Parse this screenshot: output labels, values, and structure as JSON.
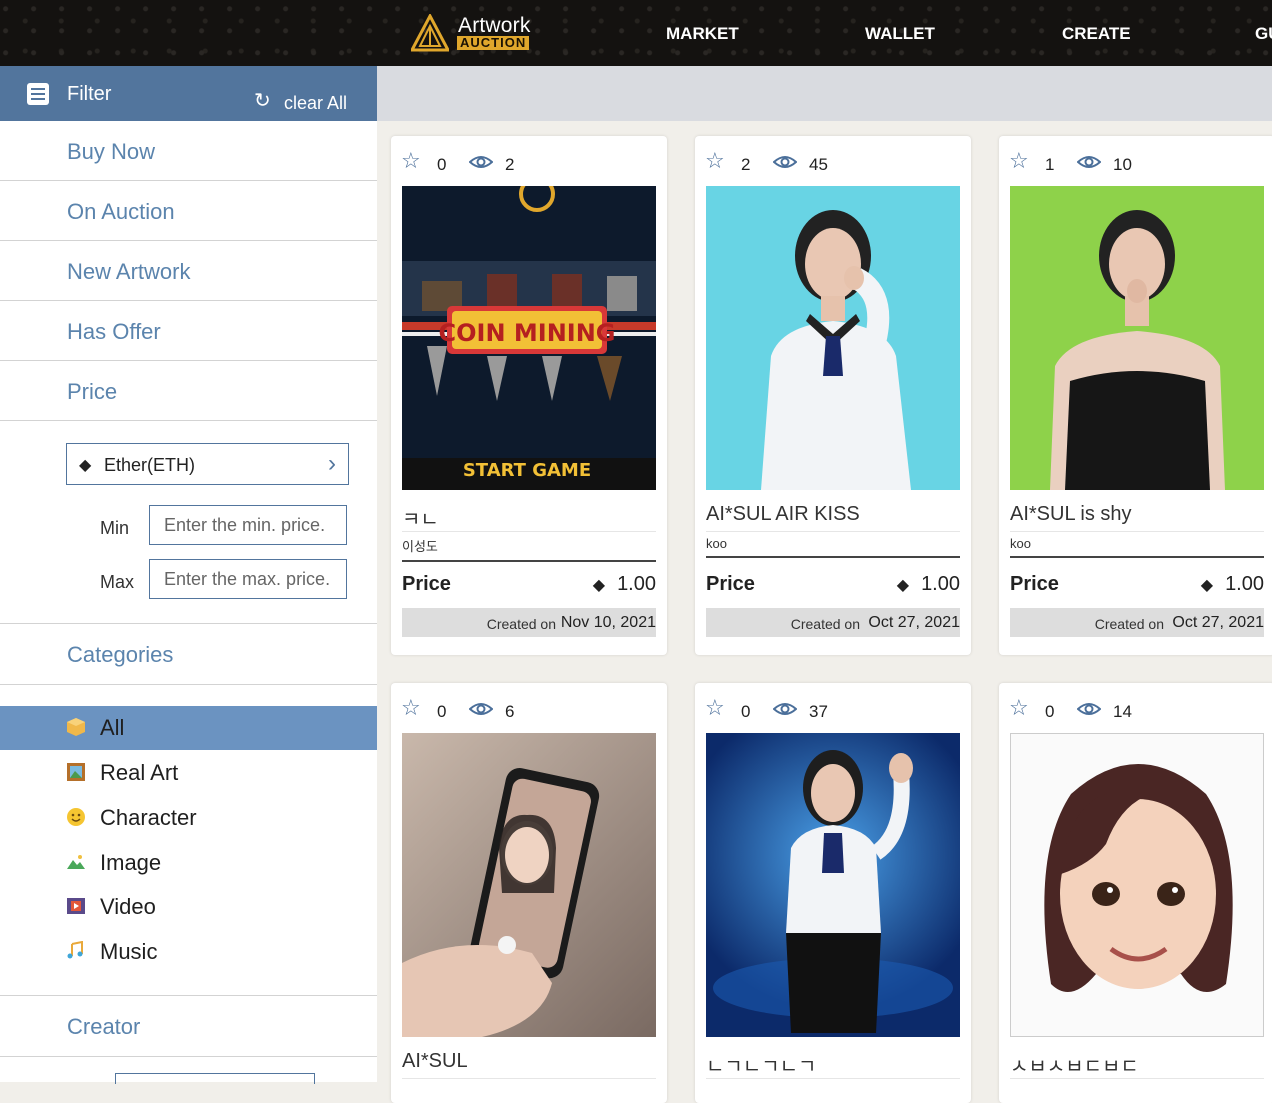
{
  "header": {
    "logo": {
      "line1": "Artwork",
      "line2": "AUCTION"
    },
    "nav": [
      "MARKET",
      "WALLET",
      "CREATE",
      "GU"
    ]
  },
  "sidebar": {
    "filter_label": "Filter",
    "clear_label": "clear All",
    "status_items": [
      "Buy Now",
      "On Auction",
      "New Artwork",
      "Has Offer",
      "Price"
    ],
    "currency": "Ether(ETH)",
    "min_label": "Min",
    "min_placeholder": "Enter the min. price.",
    "max_label": "Max",
    "max_placeholder": "Enter the max. price.",
    "categories_label": "Categories",
    "categories": [
      {
        "label": "All",
        "icon": "box-icon",
        "active": true
      },
      {
        "label": "Real Art",
        "icon": "picture-icon",
        "active": false
      },
      {
        "label": "Character",
        "icon": "smiley-icon",
        "active": false
      },
      {
        "label": "Image",
        "icon": "image-icon",
        "active": false
      },
      {
        "label": "Video",
        "icon": "film-icon",
        "active": false
      },
      {
        "label": "Music",
        "icon": "music-icon",
        "active": false
      }
    ],
    "creator_label": "Creator"
  },
  "cards": [
    {
      "stars": "0",
      "views": "2",
      "title": "ㅋㄴ",
      "creator": "이성도",
      "price_label": "Price",
      "price": "1.00",
      "created_label": "Created on",
      "created_date": "Nov 10, 2021",
      "image": "coin-mining-game"
    },
    {
      "stars": "2",
      "views": "45",
      "title": "AI*SUL AIR KISS",
      "creator": "koo",
      "price_label": "Price",
      "price": "1.00",
      "created_label": "Created on",
      "created_date": "Oct 27, 2021",
      "image": "woman-blue-bg"
    },
    {
      "stars": "1",
      "views": "10",
      "title": "AI*SUL is shy",
      "creator": "koo",
      "price_label": "Price",
      "price": "1.00",
      "created_label": "Created on",
      "created_date": "Oct 27, 2021",
      "image": "woman-green-bg"
    },
    {
      "stars": "0",
      "views": "6",
      "title": "AI*SUL",
      "image": "phone-selfie"
    },
    {
      "stars": "0",
      "views": "37",
      "title": "ㄴㄱㄴㄱㄴㄱ",
      "image": "woman-stage"
    },
    {
      "stars": "0",
      "views": "14",
      "title": "ㅅㅂㅅㅂㄷㅂㄷ",
      "image": "avatar-girl"
    }
  ],
  "card_image_texts": {
    "coin_mining": "COIN MINING",
    "start_game": "START GAME"
  },
  "colors": {
    "accent": "#52759d",
    "active_category": "#6b93c1",
    "link": "#5b84ad",
    "logo_gold": "#e0a72c"
  }
}
